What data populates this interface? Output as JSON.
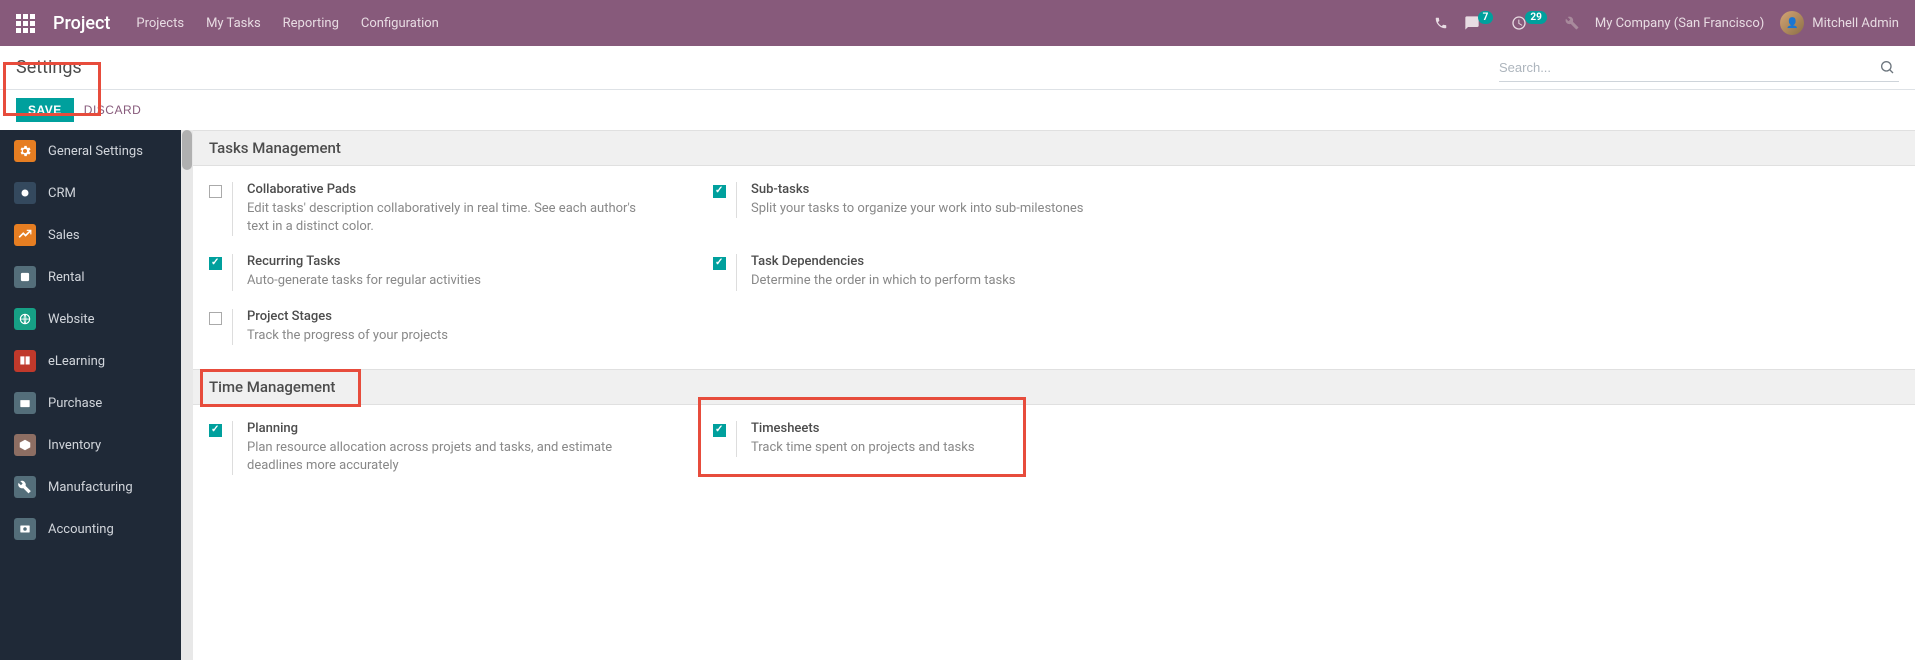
{
  "navbar": {
    "brand": "Project",
    "menu": [
      "Projects",
      "My Tasks",
      "Reporting",
      "Configuration"
    ],
    "messages_count": "7",
    "activities_count": "29",
    "company": "My Company (San Francisco)",
    "user": "Mitchell Admin"
  },
  "breadcrumb": {
    "title": "Settings",
    "search_placeholder": "Search..."
  },
  "actions": {
    "save": "SAVE",
    "discard": "DISCARD"
  },
  "sidebar": [
    {
      "label": "General Settings",
      "icon": "gear"
    },
    {
      "label": "CRM",
      "icon": "crm"
    },
    {
      "label": "Sales",
      "icon": "sales"
    },
    {
      "label": "Rental",
      "icon": "rental"
    },
    {
      "label": "Website",
      "icon": "web"
    },
    {
      "label": "eLearning",
      "icon": "elearn"
    },
    {
      "label": "Purchase",
      "icon": "purchase"
    },
    {
      "label": "Inventory",
      "icon": "inv"
    },
    {
      "label": "Manufacturing",
      "icon": "mfg"
    },
    {
      "label": "Accounting",
      "icon": "acc"
    }
  ],
  "sections": [
    {
      "title": "Tasks Management",
      "settings": [
        {
          "checked": false,
          "title": "Collaborative Pads",
          "desc": "Edit tasks' description collaboratively in real time. See each author's text in a distinct color."
        },
        {
          "checked": true,
          "title": "Sub-tasks",
          "desc": "Split your tasks to organize your work into sub-milestones"
        },
        {
          "checked": true,
          "title": "Recurring Tasks",
          "desc": "Auto-generate tasks for regular activities"
        },
        {
          "checked": true,
          "title": "Task Dependencies",
          "desc": "Determine the order in which to perform tasks"
        },
        {
          "checked": false,
          "title": "Project Stages",
          "desc": "Track the progress of your projects"
        }
      ]
    },
    {
      "title": "Time Management",
      "settings": [
        {
          "checked": true,
          "title": "Planning",
          "desc": "Plan resource allocation across projets and tasks, and estimate deadlines more accurately"
        },
        {
          "checked": true,
          "title": "Timesheets",
          "desc": "Track time spent on projects and tasks"
        }
      ]
    }
  ]
}
